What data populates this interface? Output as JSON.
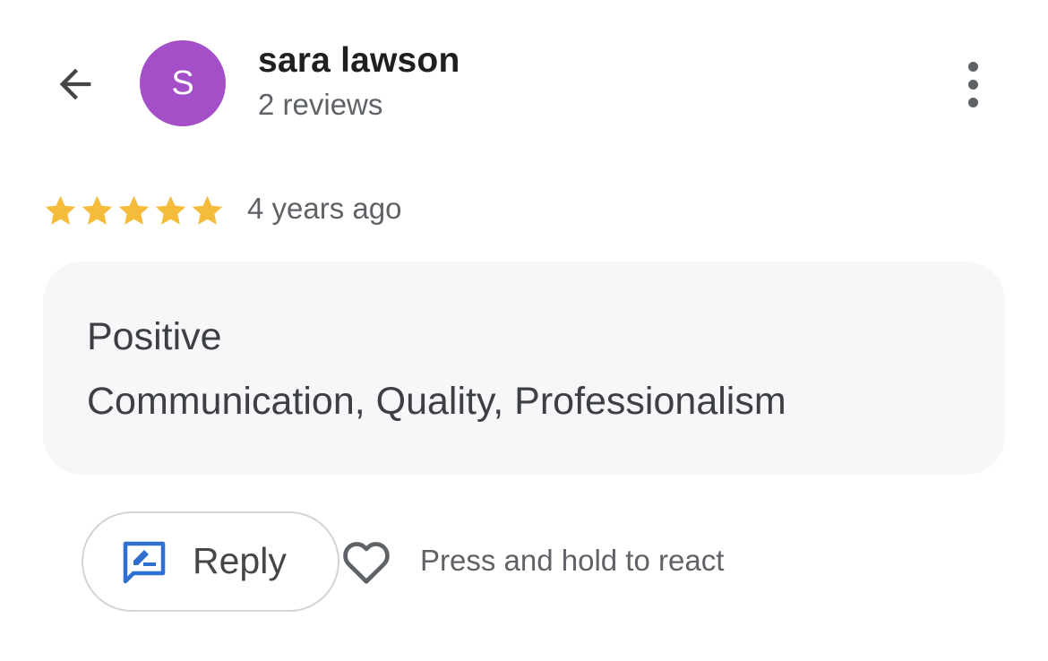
{
  "reviewer": {
    "avatar_initial": "S",
    "name": "sara lawson",
    "review_count": "2 reviews"
  },
  "review": {
    "rating": 5,
    "rating_max": 5,
    "time": "4 years ago"
  },
  "attributes": {
    "heading": "Positive",
    "values": "Communication, Quality, Professionalism"
  },
  "actions": {
    "reply_label": "Reply",
    "react_hint": "Press and hold to react"
  },
  "colors": {
    "avatar": "#a44fc7",
    "star": "#f4bc3a",
    "reply_icon": "#2f6fd0",
    "card_background": "#f7f7f9"
  },
  "icons": {
    "back": "arrow-left-icon",
    "more": "more-vert-icon",
    "star": "star-icon",
    "reply": "reply-edit-icon",
    "react": "heart-outline-icon"
  }
}
